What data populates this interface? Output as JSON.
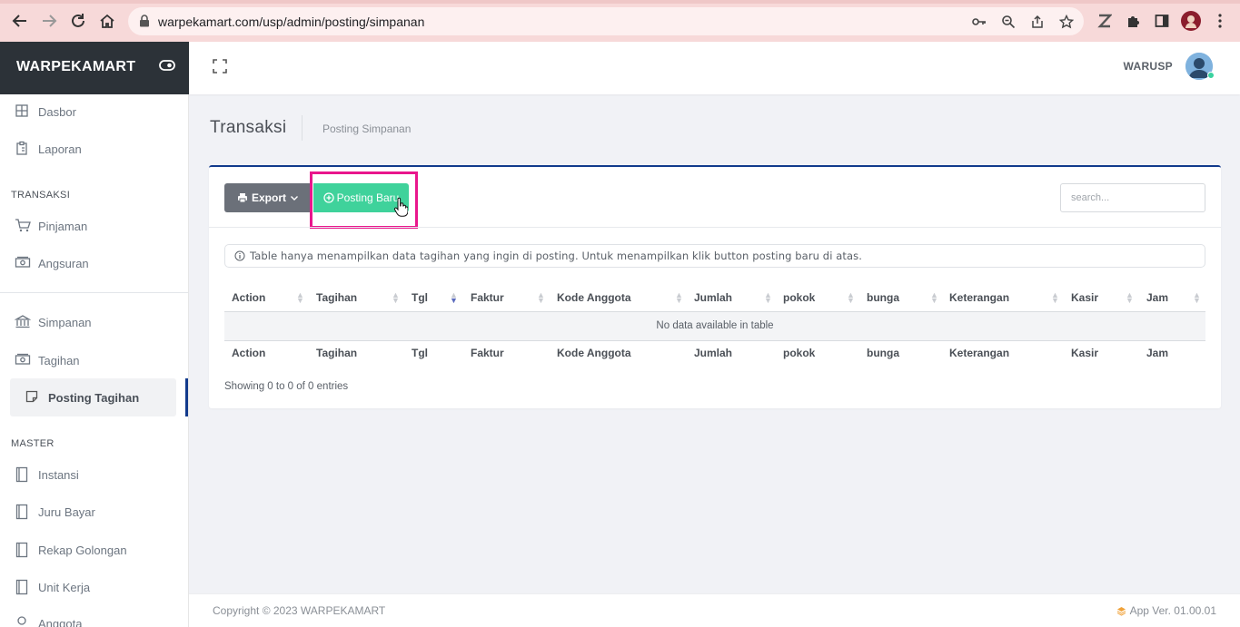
{
  "browser": {
    "url": "warpekamart.com/usp/admin/posting/simpanan"
  },
  "sidebar": {
    "brand": "WARPEKAMART",
    "items_top": [
      {
        "label": "Dasbor",
        "icon": "grid-icon"
      },
      {
        "label": "Laporan",
        "icon": "clipboard-icon"
      }
    ],
    "section_transaksi": "TRANSAKSI",
    "items_transaksi": [
      {
        "label": "Pinjaman",
        "icon": "cart-icon"
      },
      {
        "label": "Angsuran",
        "icon": "cash-icon"
      }
    ],
    "items_mid": [
      {
        "label": "Simpanan",
        "icon": "bank-icon"
      },
      {
        "label": "Tagihan",
        "icon": "cash-icon"
      },
      {
        "label": "Posting Tagihan",
        "icon": "note-icon"
      }
    ],
    "section_master": "MASTER",
    "items_master": [
      {
        "label": "Instansi",
        "icon": "book-icon"
      },
      {
        "label": "Juru Bayar",
        "icon": "book-icon"
      },
      {
        "label": "Rekap Golongan",
        "icon": "book-icon"
      },
      {
        "label": "Unit Kerja",
        "icon": "book-icon"
      },
      {
        "label": "Anggota",
        "icon": "user-icon"
      }
    ]
  },
  "header": {
    "user": "WARUSP"
  },
  "page": {
    "title": "Transaksi",
    "breadcrumb": "Posting Simpanan"
  },
  "toolbar": {
    "export_label": "Export",
    "posting_label": "Posting Baru",
    "search_placeholder": "search..."
  },
  "info": "Table hanya menampilkan data tagihan yang ingin di posting. Untuk menampilkan klik button posting baru di atas.",
  "table": {
    "columns": [
      "Action",
      "Tagihan",
      "Tgl",
      "Faktur",
      "Kode Anggota",
      "Jumlah",
      "pokok",
      "bunga",
      "Keterangan",
      "Kasir",
      "Jam"
    ],
    "empty": "No data available in table",
    "showing": "Showing 0 to 0 of 0 entries"
  },
  "footer": {
    "copyright": "Copyright © 2023 WARPEKAMART",
    "version": "App Ver. 01.00.01"
  },
  "colors": {
    "brand_bg": "#2c3238",
    "accent": "#123a8c",
    "posting_button": "#3fd29b",
    "highlight": "#e9168c"
  }
}
